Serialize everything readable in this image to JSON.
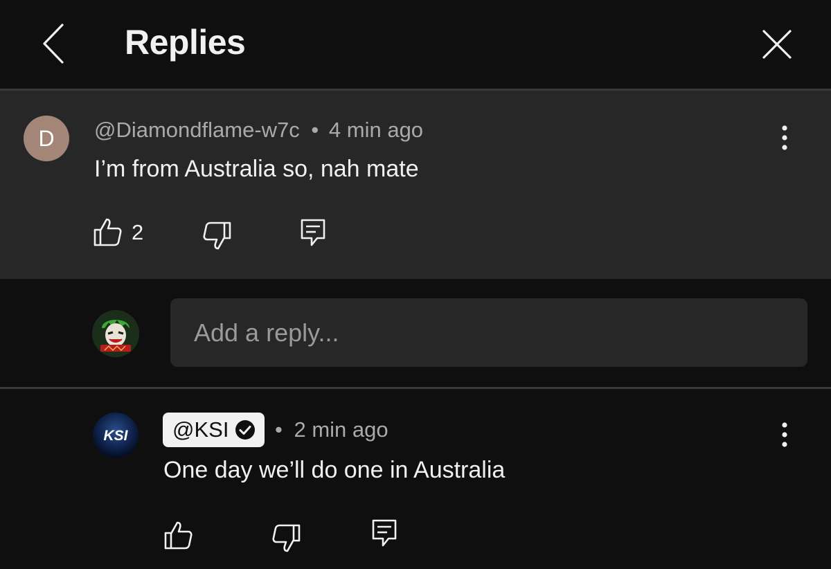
{
  "header": {
    "title": "Replies",
    "back_icon": "chevron-left-icon",
    "close_icon": "close-icon"
  },
  "parent_comment": {
    "avatar_letter": "D",
    "avatar_color": "#a38677",
    "handle": "@Diamondflame-w7c",
    "separator": "•",
    "time": "4 min ago",
    "text": "I’m from Australia so, nah mate",
    "like_count": "2"
  },
  "reply_box": {
    "placeholder": "Add a reply..."
  },
  "reply": {
    "avatar_text": "KSI",
    "handle": "@KSI",
    "verified": true,
    "separator": "•",
    "time": "2 min ago",
    "text": "One day we’ll do one in Australia"
  },
  "colors": {
    "background": "#0f0f0f",
    "highlight": "#272727",
    "text_primary": "#f1f1f1",
    "text_secondary": "#aaaaaa"
  }
}
